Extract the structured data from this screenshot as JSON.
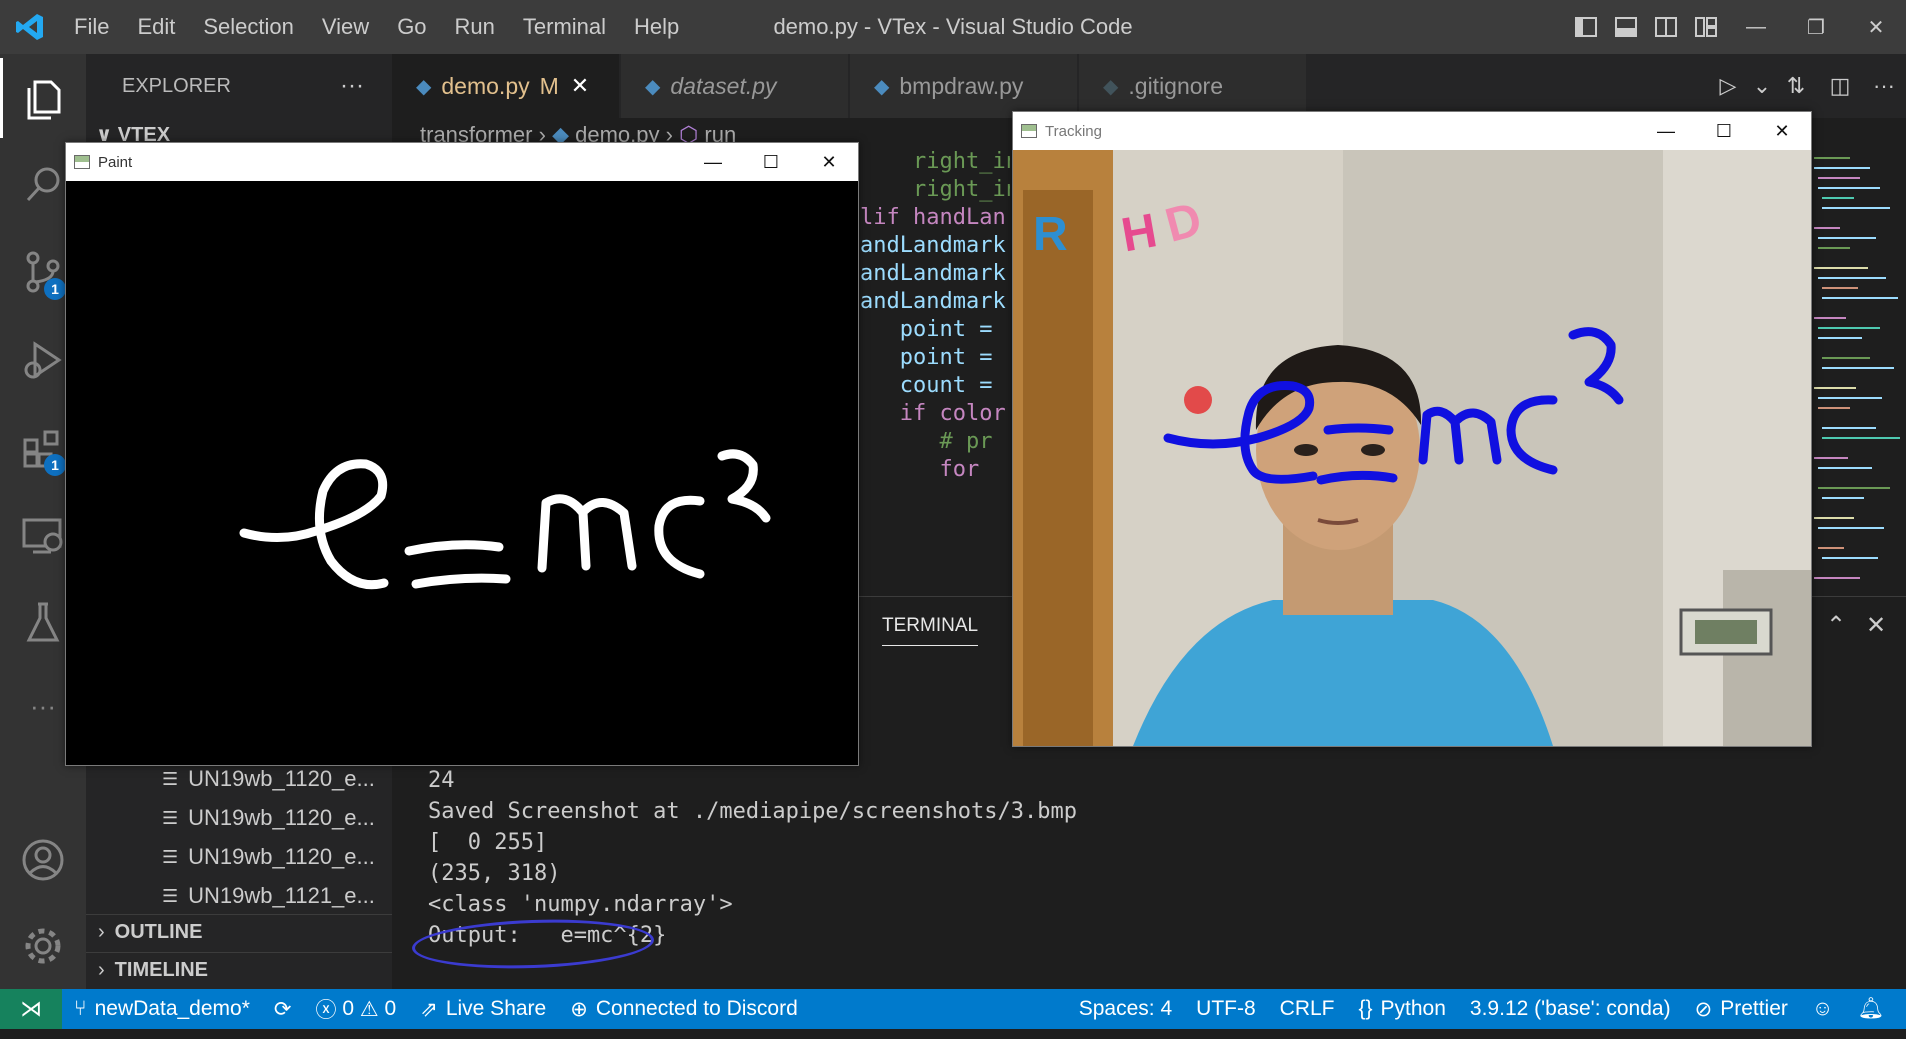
{
  "menu": [
    "File",
    "Edit",
    "Selection",
    "View",
    "Go",
    "Run",
    "Terminal",
    "Help"
  ],
  "window_title": "demo.py - VTex - Visual Studio Code",
  "activity_badges": {
    "source_control": "1",
    "extensions": "1"
  },
  "sidebar": {
    "header": "EXPLORER",
    "more": "···",
    "root": "VTEX",
    "files": [
      "UN19wb_1120_e...",
      "UN19wb_1120_e...",
      "UN19wb_1120_e...",
      "UN19wb_1121_e..."
    ],
    "outline": "OUTLINE",
    "timeline": "TIMELINE"
  },
  "tabs": [
    {
      "label": "demo.py",
      "modified": "M",
      "active": true
    },
    {
      "label": "dataset.py",
      "italic": true
    },
    {
      "label": "bmpdraw.py"
    },
    {
      "label": ".gitignore"
    }
  ],
  "breadcrumb": {
    "folder": "transformer",
    "file": "demo.py",
    "symbol": "run"
  },
  "code_lines": [
    "    right_inde",
    "    right_inde",
    "lif handLan",
    "andLandmark",
    "andLandmark",
    "andLandmark",
    "   point = ",
    "   point = ",
    "   count = ",
    "   if color",
    "      # pr",
    "      for "
  ],
  "terminal": {
    "tab_label": "TERMINAL",
    "lines": [
      "24",
      "Saved Screenshot at ./mediapipe/screenshots/3.bmp",
      "[  0 255]",
      "(235, 318)",
      "<class 'numpy.ndarray'>",
      "Output:   e=mc^{2}"
    ]
  },
  "paint_window": {
    "title": "Paint",
    "drawn_text": "e=mc²"
  },
  "tracking_window": {
    "title": "Tracking",
    "drawn_text": "e=mc²"
  },
  "statusbar": {
    "branch": "newData_demo*",
    "errors": "0",
    "warnings": "0",
    "live_share": "Live Share",
    "discord": "Connected to Discord",
    "spaces": "Spaces: 4",
    "encoding": "UTF-8",
    "eol": "CRLF",
    "language": "Python",
    "interpreter": "3.9.12 ('base': conda)",
    "prettier": "Prettier"
  },
  "colors": {
    "status_bar": "#007acc",
    "remote": "#16825d",
    "stroke_blue": "#1010e0",
    "circle": "#3b3bd0"
  }
}
